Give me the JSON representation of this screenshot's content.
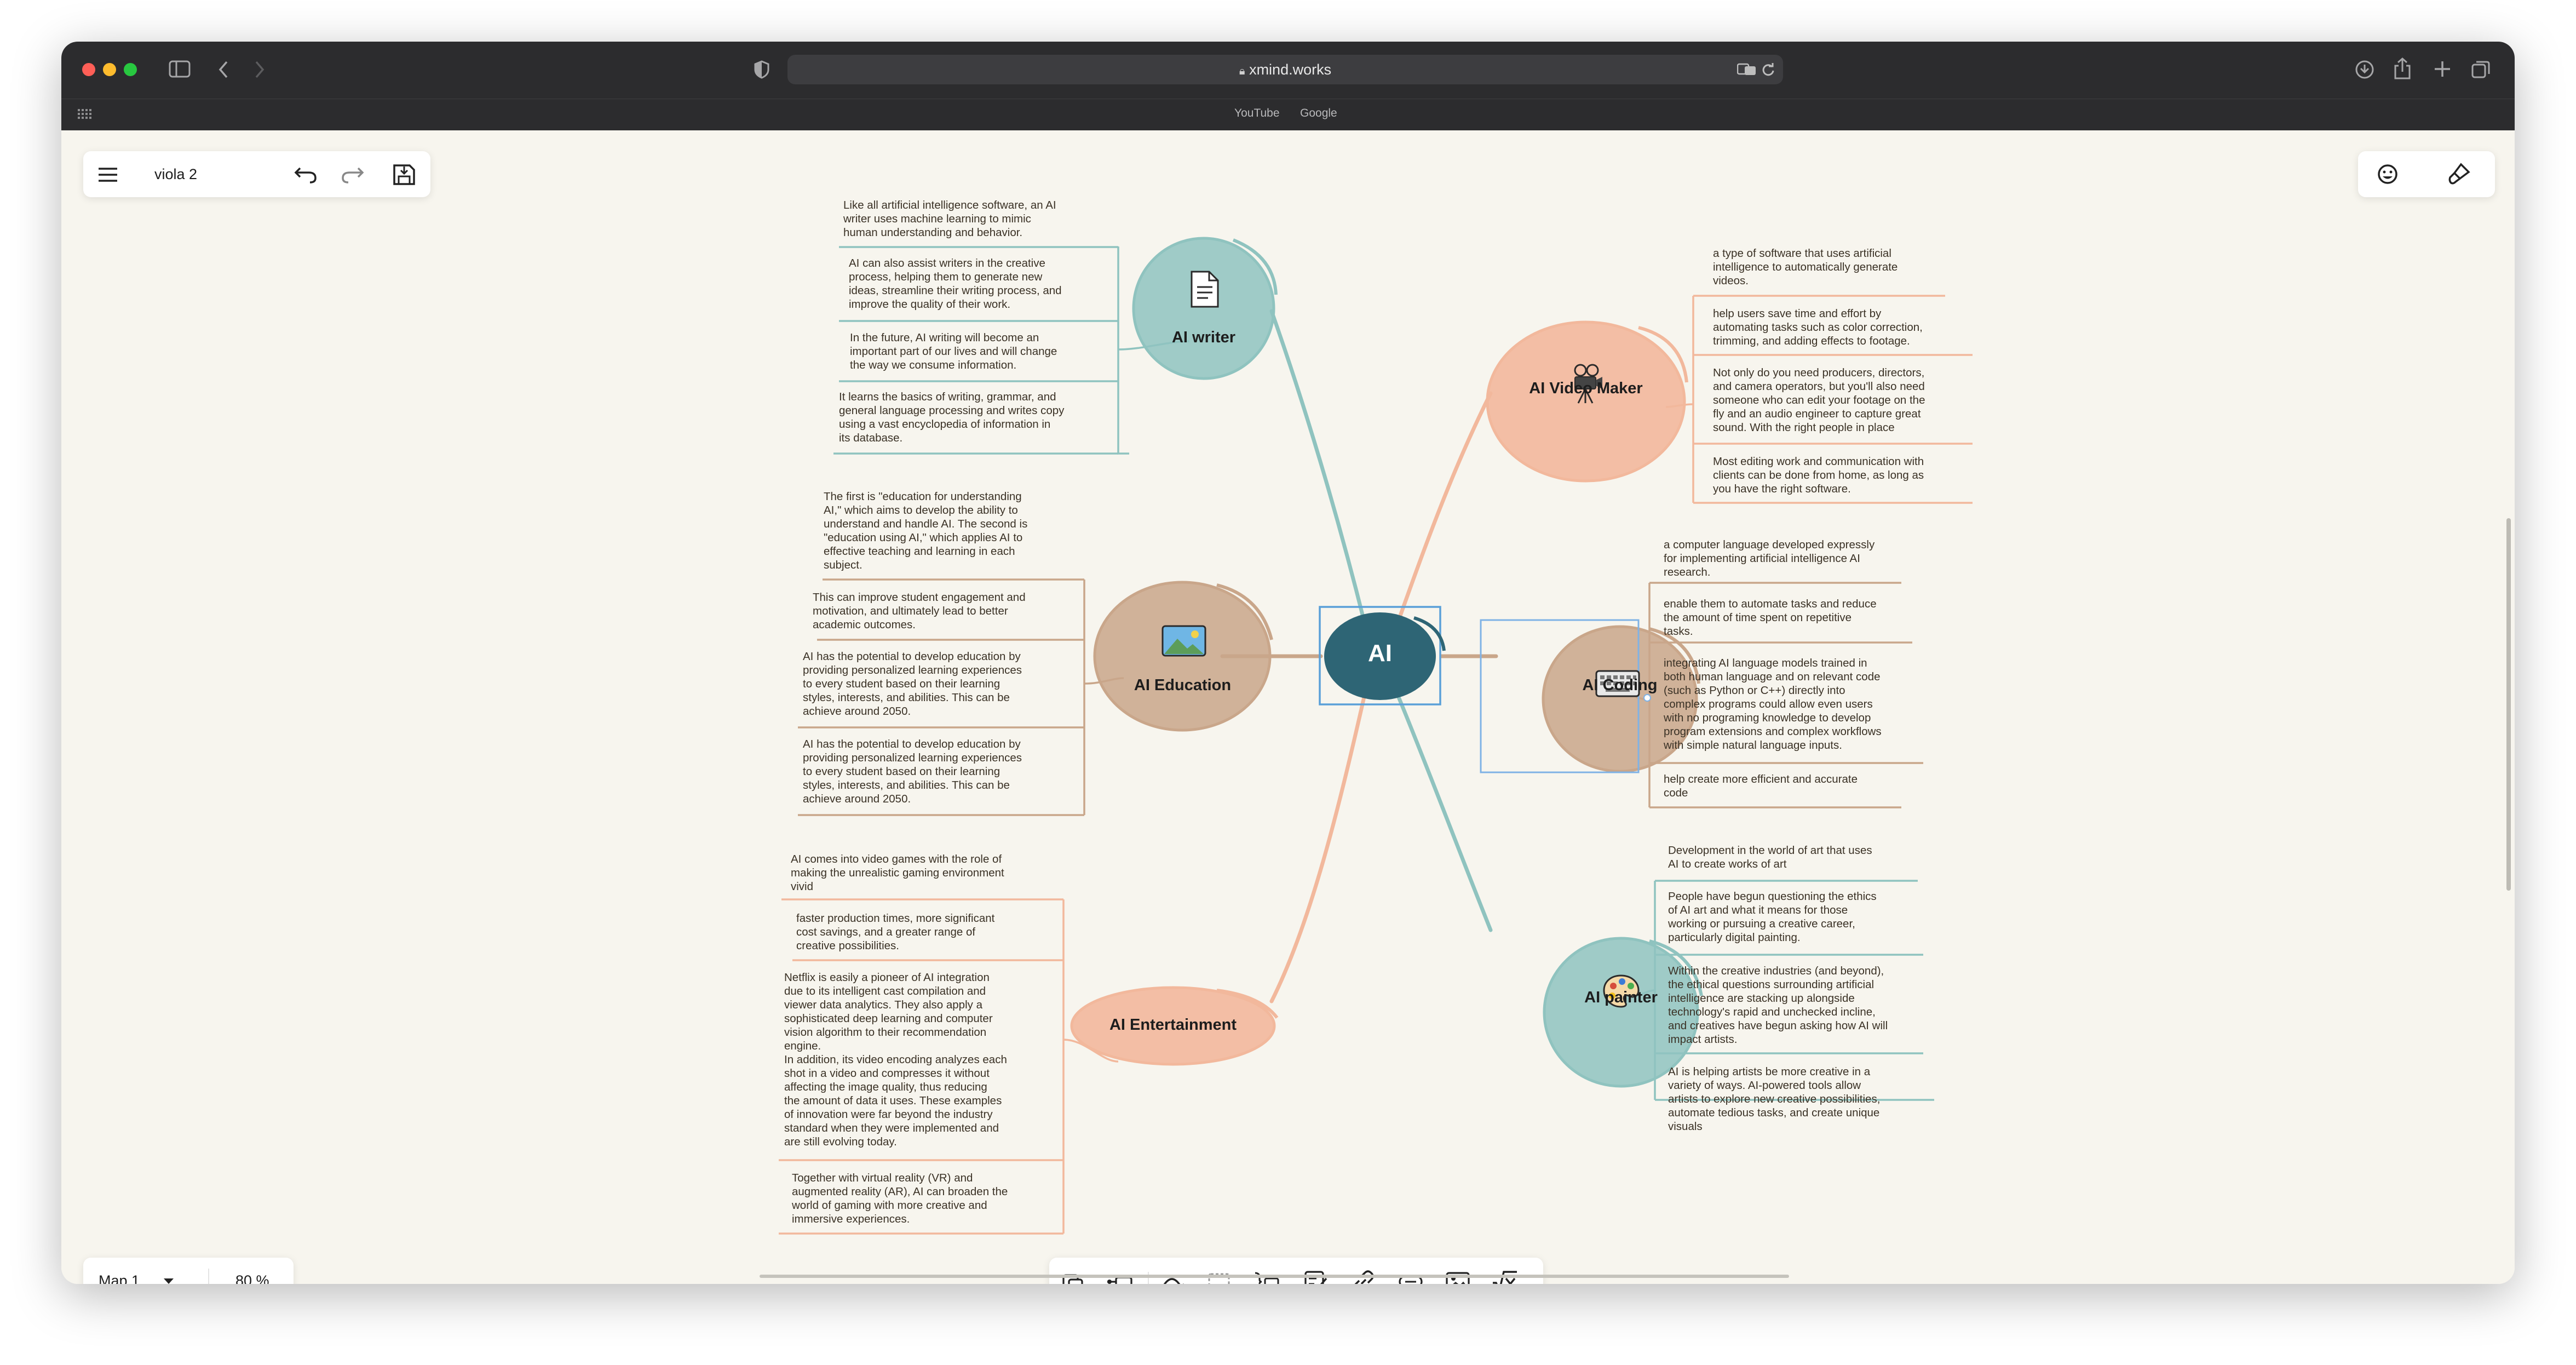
{
  "browser": {
    "url": "xmind.works",
    "bookmarks": [
      "YouTube",
      "Google"
    ]
  },
  "app": {
    "file_name": "viola 2",
    "sheet_name": "Map 1",
    "zoom": "80 %"
  },
  "map": {
    "central_topic": "AI",
    "topics": [
      {
        "label": "AI writer",
        "icon": "document-icon",
        "color": "#8fc3bf",
        "notes": [
          "Like all artificial intelligence software, an AI\nwriter uses machine learning to mimic\nhuman understanding and behavior.",
          "AI can also assist writers in the creative\nprocess, helping them to generate new\nideas, streamline their writing process, and\nimprove the quality of their work.",
          "In the future, AI writing will become an\nimportant part of our lives and will change\nthe way we consume information.",
          "It learns the basics of writing, grammar, and\ngeneral language processing and writes copy\nusing a vast encyclopedia of information in\nits database."
        ]
      },
      {
        "label": "AI Education",
        "icon": "picture-icon",
        "color": "#c9a68a",
        "notes": [
          "The first is \"education for understanding\nAI,\" which aims to develop the ability to\nunderstand and handle AI. The second is\n\"education using AI,\" which applies AI to\neffective teaching and learning in each\nsubject.",
          "This can improve student engagement and\nmotivation, and ultimately lead to better\nacademic outcomes.",
          "AI has the potential to develop education by\nproviding personalized learning experiences\nto every student based on their learning\nstyles, interests, and abilities. This can be\nachieve around 2050.",
          "AI has the potential to develop education by\nproviding personalized learning experiences\nto every student based on their learning\nstyles, interests, and abilities. This can be\nachieve around 2050."
        ]
      },
      {
        "label": "AI Entertainment",
        "icon": "",
        "color": "#f2b89c",
        "notes": [
          "AI comes into video games with the role of\nmaking the unrealistic gaming environment\nvivid",
          "faster production times, more significant\ncost savings, and a greater range of\ncreative possibilities.",
          "Netflix is easily a pioneer of AI integration\ndue to its intelligent cast compilation and\nviewer data analytics. They also apply a\nsophisticated deep learning and computer\nvision algorithm to their recommendation\nengine.\nIn addition, its video encoding analyzes each\nshot in a video and compresses it without\naffecting the image quality, thus reducing\nthe amount of data it uses. These examples\nof innovation were far beyond the industry\nstandard when they were implemented and\nare still evolving today.",
          "Together with virtual reality (VR) and\naugmented reality (AR), AI can broaden the\nworld of gaming with more creative and\nimmersive experiences."
        ]
      },
      {
        "label": "AI Video Maker",
        "icon": "movie-camera-icon",
        "color": "#f2b89c",
        "notes": [
          "a type of software that uses artificial\nintelligence to automatically generate\nvideos.",
          "help users save time and effort by\nautomating tasks such as color correction,\ntrimming, and adding effects to footage.",
          "Not only do you need producers, directors,\nand camera operators, but you'll also need\nsomeone who can edit your footage on the\nfly and an audio engineer to capture great\nsound. With the right people in place",
          "Most editing work and communication with\nclients can be done from home, as long as\nyou have the right software."
        ]
      },
      {
        "label": "AI Coding",
        "icon": "keyboard-icon",
        "color": "#c9a68a",
        "notes": [
          "a computer language developed expressly\nfor implementing artificial intelligence AI\nresearch.",
          "enable them to automate tasks and reduce\nthe amount of time spent on repetitive\ntasks.",
          "integrating AI language models trained in\nboth human language and on relevant code\n(such as Python or C++) directly into\ncomplex programs could allow even users\nwith no programing knowledge to develop\nprogram extensions and complex workflows\nwith simple natural language inputs.",
          "help create more efficient and accurate\ncode"
        ]
      },
      {
        "label": "AI painter",
        "icon": "palette-icon",
        "color": "#8fc3bf",
        "notes": [
          "Development in the world of art that uses\nAI to create works of art",
          "People have begun questioning the ethics\nof AI art and what it means for those\nworking or pursuing a creative career,\nparticularly digital painting.",
          "Within the creative industries (and beyond),\nthe ethical questions surrounding artificial\nintelligence are stacking up alongside\ntechnology's rapid and unchecked incline,\nand creatives have begun asking how AI will\nimpact artists.",
          "AI is helping artists be more creative in a\nvariety of ways. AI-powered tools allow\nartists to explore new creative possibilities,\nautomate tedious tasks, and create unique\nvisuals"
        ]
      }
    ]
  },
  "colors": {
    "teal": "#8fc3bf",
    "brown": "#c9a68a",
    "salmon": "#f2b89c",
    "central": "#2e6575",
    "selection": "#7fb2e5"
  }
}
